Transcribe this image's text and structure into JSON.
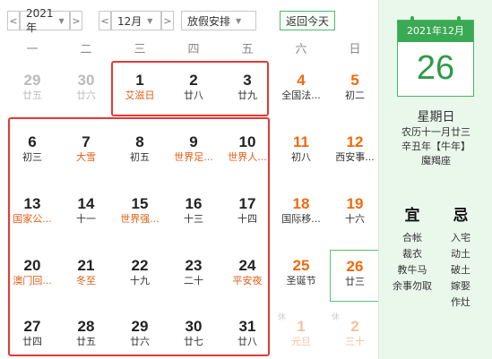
{
  "toolbar": {
    "prev_year": "<",
    "year": "2021年",
    "next_year": ">",
    "prev_month": "<",
    "month": "12月",
    "next_month": ">",
    "holiday_select": "放假安排",
    "today_button": "返回今天"
  },
  "weekdays": [
    "一",
    "二",
    "三",
    "四",
    "五",
    "六",
    "日"
  ],
  "days": [
    {
      "num": "29",
      "lunar": "廿五",
      "other": true,
      "weekend": false
    },
    {
      "num": "30",
      "lunar": "廿六",
      "other": true,
      "weekend": false
    },
    {
      "num": "1",
      "lunar": "艾滋日",
      "fest": true
    },
    {
      "num": "2",
      "lunar": "廿八"
    },
    {
      "num": "3",
      "lunar": "廿九"
    },
    {
      "num": "4",
      "lunar": "全国法...",
      "fest": true,
      "weekend": true
    },
    {
      "num": "5",
      "lunar": "初二",
      "weekend": true
    },
    {
      "num": "6",
      "lunar": "初三"
    },
    {
      "num": "7",
      "lunar": "大雪",
      "fest": true
    },
    {
      "num": "8",
      "lunar": "初五"
    },
    {
      "num": "9",
      "lunar": "世界足...",
      "fest": true
    },
    {
      "num": "10",
      "lunar": "世界人...",
      "fest": true
    },
    {
      "num": "11",
      "lunar": "初八",
      "weekend": true
    },
    {
      "num": "12",
      "lunar": "西安事...",
      "fest": true,
      "weekend": true
    },
    {
      "num": "13",
      "lunar": "国家公...",
      "fest": true
    },
    {
      "num": "14",
      "lunar": "十一"
    },
    {
      "num": "15",
      "lunar": "世界强...",
      "fest": true
    },
    {
      "num": "16",
      "lunar": "十三"
    },
    {
      "num": "17",
      "lunar": "十四"
    },
    {
      "num": "18",
      "lunar": "国际移...",
      "fest": true,
      "weekend": true
    },
    {
      "num": "19",
      "lunar": "十六",
      "weekend": true
    },
    {
      "num": "20",
      "lunar": "澳门回...",
      "fest": true
    },
    {
      "num": "21",
      "lunar": "冬至",
      "fest": true
    },
    {
      "num": "22",
      "lunar": "十九"
    },
    {
      "num": "23",
      "lunar": "二十"
    },
    {
      "num": "24",
      "lunar": "平安夜",
      "fest": true
    },
    {
      "num": "25",
      "lunar": "圣诞节",
      "fest": true,
      "weekend": true
    },
    {
      "num": "26",
      "lunar": "廿三",
      "weekend": true,
      "selected": true
    },
    {
      "num": "27",
      "lunar": "廿四"
    },
    {
      "num": "28",
      "lunar": "廿五"
    },
    {
      "num": "29",
      "lunar": "廿六"
    },
    {
      "num": "30",
      "lunar": "廿七"
    },
    {
      "num": "31",
      "lunar": "廿八"
    },
    {
      "num": "1",
      "lunar": "元旦",
      "other": true,
      "weekend": true,
      "badge": "休"
    },
    {
      "num": "2",
      "lunar": "三十",
      "other": true,
      "weekend": true,
      "badge": "休"
    }
  ],
  "panel": {
    "pad_header": "2021年12月",
    "pad_day": "26",
    "weekday": "星期日",
    "lunar_date": "农历十一月廿三",
    "ganzhi": "辛丑年【牛年】",
    "constellation": "魔羯座",
    "yi_title": "宜",
    "yi_items": [
      "合帐",
      "裁衣",
      "教牛马",
      "余事勿取"
    ],
    "ji_title": "忌",
    "ji_items": [
      "入宅",
      "动土",
      "破土",
      "嫁娶",
      "作灶"
    ]
  },
  "colors": {
    "accent_green": "#3aa954",
    "weekend_orange": "#f06a0e",
    "highlight_red": "#e53935"
  }
}
